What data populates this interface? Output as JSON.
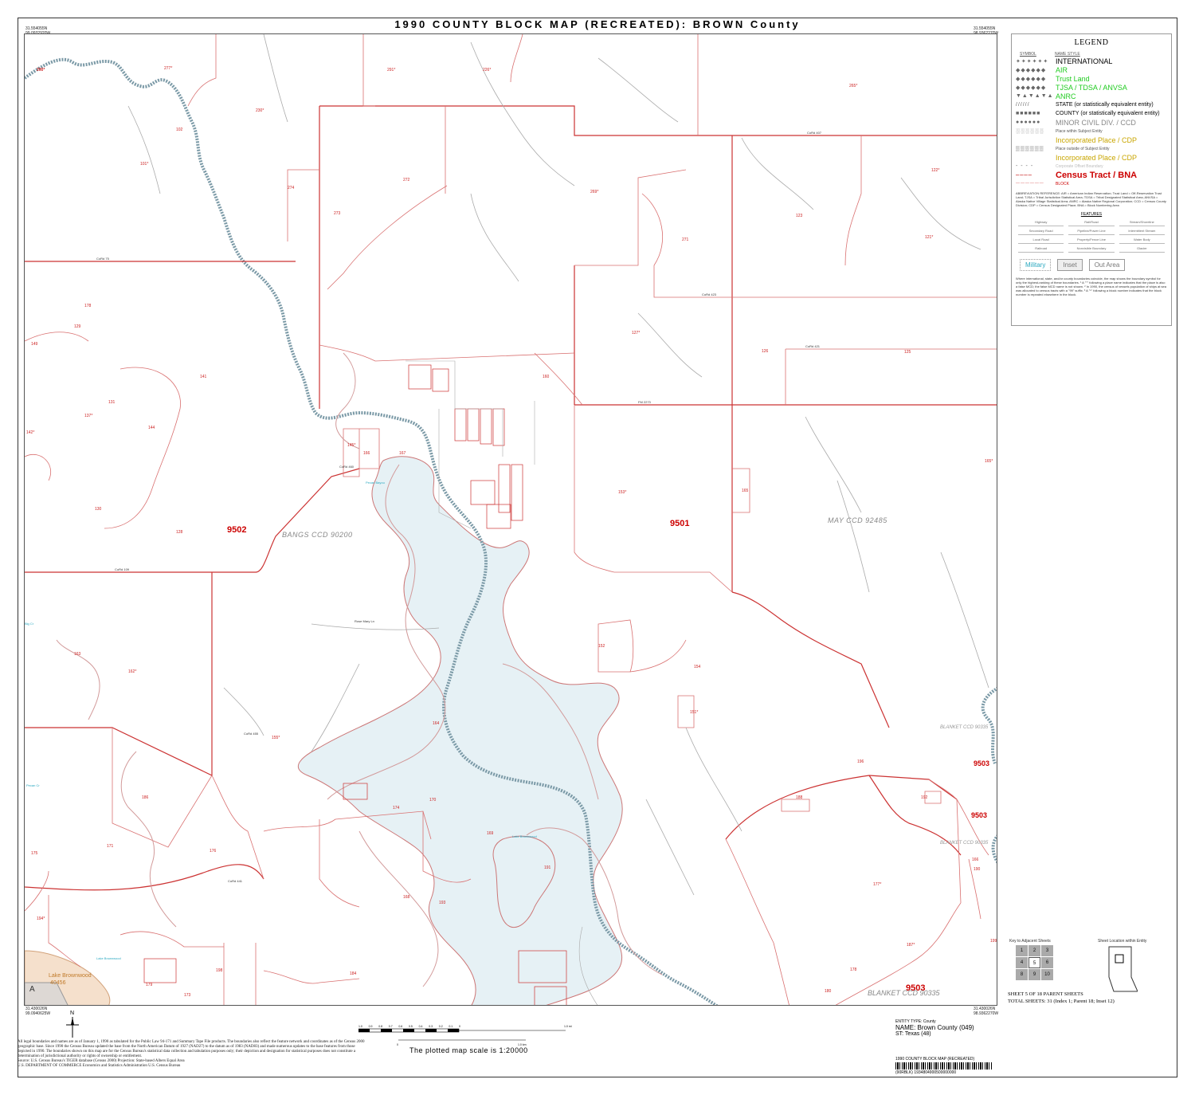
{
  "title": "1990 COUNTY BLOCK MAP (RECREATED): BROWN County",
  "corners": {
    "top_left": [
      "31.554055N",
      "99.0932920W"
    ],
    "top_right": [
      "31.554055N",
      "98.9362270W"
    ],
    "bottom_left": [
      "31.430026N",
      "99.0940625W"
    ],
    "bottom_right": [
      "31.430026N",
      "98.9362270W"
    ]
  },
  "map": {
    "tracts": [
      {
        "label": "9502"
      },
      {
        "label": "9501"
      },
      {
        "label": "9503"
      },
      {
        "label": "9503"
      },
      {
        "label": "9503"
      }
    ],
    "ccds": [
      {
        "label": "BANGS CCD 90200"
      },
      {
        "label": "MAY CCD 92485"
      },
      {
        "label": "BLANKET CCD 90335"
      },
      {
        "label": "BLANKET CCD 90335"
      },
      {
        "label": "BLANKET CCD 90335"
      }
    ],
    "blocks": [
      "276*",
      "277*",
      "291*",
      "226*",
      "265*",
      "230*",
      "102",
      "101*",
      "274",
      "273",
      "272",
      "269*",
      "271",
      "123",
      "122*",
      "121*",
      "178",
      "129",
      "149",
      "141",
      "160",
      "127*",
      "126",
      "125",
      "131",
      "137*",
      "144",
      "142*",
      "145*",
      "166",
      "167",
      "165",
      "130",
      "128",
      "153*",
      "154",
      "163",
      "162*",
      "152",
      "151*",
      "164",
      "155*",
      "196",
      "188",
      "192",
      "186",
      "174",
      "170",
      "169",
      "168",
      "171",
      "175",
      "176",
      "177*",
      "166",
      "190",
      "191",
      "193",
      "194*",
      "187*",
      "184",
      "198",
      "173",
      "179",
      "178",
      "180",
      "199",
      "165*",
      "160*"
    ],
    "roads": [
      "CoRd 407",
      "CoRd 423",
      "CoRd 421",
      "FM 2273",
      "CoRd 75",
      "CoRd 109",
      "CoRd 460",
      "Rose Mary Ln",
      "CoRd 455",
      "CoRd 441",
      "FM 2559",
      "CoRd 435",
      "CoRd 436",
      "CoRd 403",
      "CoRd 411",
      "CoRd 442",
      "CoRd 428",
      "Deep Water Harbor Rd",
      "CoRd 443"
    ],
    "water": [
      "Pecan Bayou",
      "Lake Brownwood",
      "Lake Brownwood",
      "Bull Cr",
      "Big Cr",
      "Pecan Cr",
      "Booth Cr"
    ],
    "place": {
      "name": "Lake Brownwood",
      "code": "40456",
      "letter": "A"
    }
  },
  "legend": {
    "title": "LEGEND",
    "headers": [
      "SYMBOL",
      "NAME STYLE"
    ],
    "rows": [
      {
        "sym": "✦✦✦✦✦✦",
        "text": "INTERNATIONAL",
        "color": "#000000"
      },
      {
        "sym": "◆◆◆◆◆◆",
        "text": "AIR",
        "color": "#22cc22"
      },
      {
        "sym": "◆◆◆◆◆◆",
        "text": "Trust Land",
        "color": "#22cc22"
      },
      {
        "sym": "◆◆◆◆◆◆",
        "text": "TJSA / TDSA / ANVSA",
        "color": "#22cc22"
      },
      {
        "sym": "▼▲▼▲▼▲",
        "text": "ANRC",
        "color": "#22cc22"
      },
      {
        "sym": "//////",
        "text": "STATE (or statistically equivalent entity)",
        "color": "#000000"
      },
      {
        "sym": "■■■■■■",
        "text": "COUNTY (or statistically equivalent entity)",
        "color": "#000000"
      },
      {
        "sym": "●●●●●●",
        "text": "MINOR CIVIL DIV. / CCD",
        "color": "#888888"
      },
      {
        "sym": "░░░░░░",
        "text": "Place within Subject Entity",
        "color": "#555555"
      },
      {
        "sym": "",
        "text": "Incorporated Place / CDP",
        "color": "#c9a600"
      },
      {
        "sym": "▒▒▒▒▒▒",
        "text": "Place outside of Subject Entity",
        "color": "#555555"
      },
      {
        "sym": "",
        "text": "Incorporated Place / CDP",
        "color": "#c9a600"
      },
      {
        "sym": "- - - -",
        "text": "Corporate Offset Boundary",
        "color": "#bbbbbb"
      },
      {
        "sym": "━━━━",
        "text": "Census Tract / BNA",
        "color": "#cc0000"
      },
      {
        "sym": "──────",
        "text": "BLOCK",
        "color": "#cc0000"
      }
    ],
    "abbreviations": "ABBREVIATION REFERENCE: AIR = American Indian Reservation; Trust Land = Off-Reservation Trust Land; TJSA = Tribal Jurisdiction Statistical Area; TDSA = Tribal Designated Statistical Area; ANVSA = Alaska Native Village Statistical Area; ANRC = Alaska Native Regional Corporation; CCD = Census County Division; CDP = Census Designated Place; BNA = Block Numbering Area",
    "features_title": "FEATURES",
    "features": [
      "Highway",
      "Rail/Road",
      "Stream/Shoreline",
      "Secondary Road",
      "Pipeline/Power Line",
      "Intermittent Stream",
      "Local Road",
      "Property/Fence Line",
      "Water Body",
      "Railroad",
      "Nonvisible Boundary",
      "Glacier"
    ],
    "boxes": [
      "Military",
      "Inset",
      "Out Area"
    ],
    "notes": "Where international, state, and/or county boundaries coincide, the map shows the boundary symbol for only the highest-ranking of these boundaries. ¹ A \"°\" following a place name indicates that the place is also a false MCD; the false MCD name is not shown. ² In 1990, the census of vessels population of ships at sea was allocated to census tracts with a \"99\" suffix. ³ A \"*\" following a block number indicates that the block number is repeated elsewhere in the block."
  },
  "key": {
    "title": "Key to Adjacent Sheets",
    "cells": [
      "1",
      "2",
      "3",
      "4",
      "5",
      "6",
      "8",
      "9",
      "10"
    ],
    "current": "5",
    "location_title": "Sheet Location within Entity"
  },
  "sheet": {
    "line1": "SHEET 5 OF 18 PARENT SHEETS",
    "line2": "TOTAL SHEETS: 31 (Index 1; Parent 18; Inset 12)"
  },
  "scale": {
    "text": "The plotted map scale is 1:20000",
    "ticks": [
      "1.0",
      "0.9",
      "0.8",
      "0.7",
      "0.6",
      "0.5",
      "0.4",
      "0.3",
      "0.2",
      "0.1",
      "0",
      "1.0 mi"
    ],
    "km_ticks": [
      "0",
      "1.0 km"
    ]
  },
  "entity": {
    "type": "ENTITY TYPE: County",
    "name": "NAME: Brown County (049)",
    "st": "ST: Texas (48)"
  },
  "barcode": {
    "title": "1990 COUNTY BLOCK MAP (RECREATED)",
    "number": "(90RBLK) 1934804900500000000"
  },
  "footnote": "All legal boundaries and names are as of January 1, 1990 as tabulated for the Public Law 94-171 and Summary Tape File products. The boundaries also reflect the feature network and coordinates as of the Census 2000 geographic base. Since 1990 the Census Bureau updated the base from the North American Datum of 1927 (NAD27) to the datum as of 1983 (NAD83) and made numerous updates to the base features from those depicted in 1990. The boundaries shown on this map are for the Census Bureau's statistical data collection and tabulation purposes only; their depiction and designation for statistical purposes does not constitute a determination of jurisdictional authority or rights of ownership or entitlement.",
  "source": "Source: U.S. Census Bureau's TIGER database (Census 2000)          Projection: State-based Albers Equal Area",
  "agency": "U.S. DEPARTMENT OF COMMERCE Economics and Statistics Administration U.S. Census Bureau",
  "colors": {
    "tract": "#cc2222",
    "block": "#cc5a5a",
    "water": "#e6f1f5",
    "county": "#6f8c99",
    "road": "#999999"
  }
}
